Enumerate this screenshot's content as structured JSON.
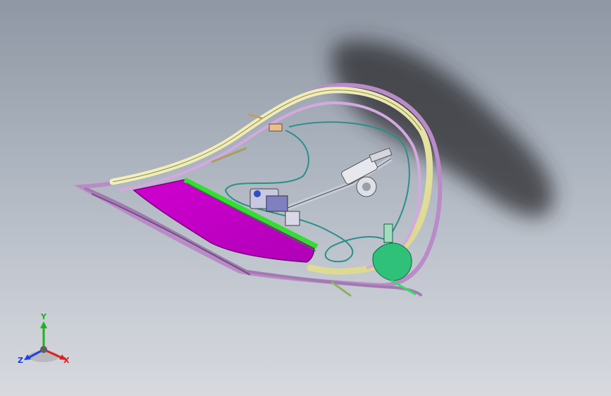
{
  "viewport": {
    "background_top": "#8f97a4",
    "background_bottom": "#d7d9df"
  },
  "model": {
    "colors": {
      "frame_outer": "#c9a0d4",
      "frame_inner_yellow": "#f3f0b4",
      "glass_magenta": "#c400c4",
      "seal_green": "#33dd33",
      "cable_teal": "#2a8f8a",
      "motor_green": "#2fc07a",
      "shadow": "#2a2a2e"
    }
  },
  "triad": {
    "x_label": "X",
    "y_label": "Y",
    "z_label": "Z",
    "x_color": "#e02020",
    "y_color": "#20b020",
    "z_color": "#2040e0",
    "icon": "coordinate-triad-icon"
  }
}
